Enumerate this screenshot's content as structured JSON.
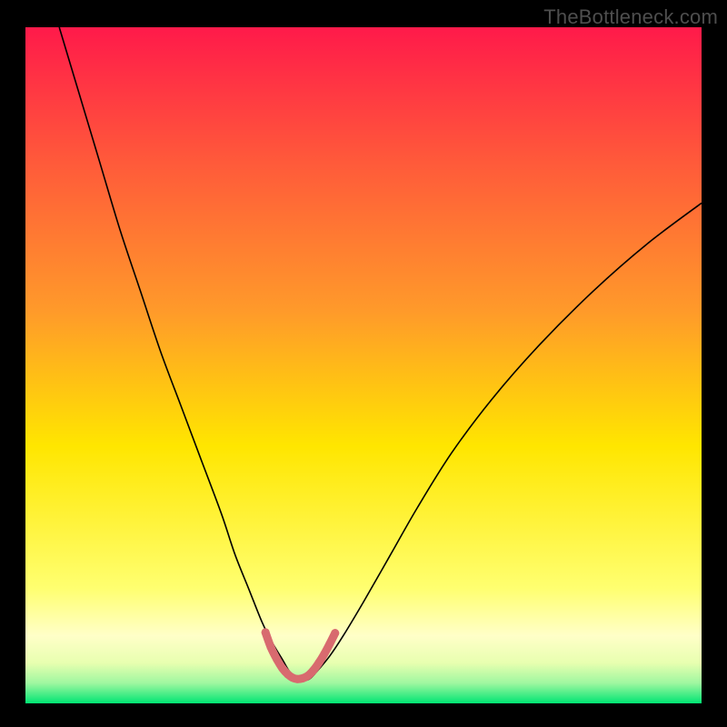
{
  "watermark": "TheBottleneck.com",
  "chart_data": {
    "type": "line",
    "title": "",
    "xlabel": "",
    "ylabel": "",
    "xlim": [
      0,
      100
    ],
    "ylim": [
      0,
      100
    ],
    "background_gradient": {
      "top": "#ff1a4a",
      "mid1": "#ff8a2a",
      "mid2": "#ffe600",
      "low": "#ffffb0",
      "bottom": "#00e573"
    },
    "series": [
      {
        "name": "bottleneck-curve",
        "color": "#000000",
        "width": 1.6,
        "x": [
          5,
          8,
          11,
          14,
          17,
          20,
          23,
          26,
          29,
          31,
          33,
          35,
          36.5,
          38,
          39,
          40,
          41,
          42,
          43,
          45,
          47,
          50,
          54,
          58,
          63,
          69,
          76,
          84,
          92,
          100
        ],
        "y": [
          100,
          90,
          80,
          70,
          61,
          52,
          44,
          36,
          28,
          22,
          17,
          12,
          9,
          6.5,
          4.8,
          3.8,
          3.4,
          3.6,
          4.6,
          7,
          10,
          15,
          22,
          29,
          37,
          45,
          53,
          61,
          68,
          74
        ]
      },
      {
        "name": "sweet-spot-marker",
        "color": "#d86a6f",
        "width": 9,
        "linecap": "round",
        "x": [
          35.5,
          36.3,
          37.2,
          38.0,
          38.8,
          39.5,
          40.2,
          41.0,
          41.8,
          42.6,
          43.4,
          44.2,
          45.0,
          45.8
        ],
        "y": [
          10.5,
          8.3,
          6.5,
          5.2,
          4.3,
          3.8,
          3.6,
          3.7,
          4.1,
          4.9,
          6.0,
          7.3,
          8.8,
          10.4
        ]
      }
    ]
  }
}
